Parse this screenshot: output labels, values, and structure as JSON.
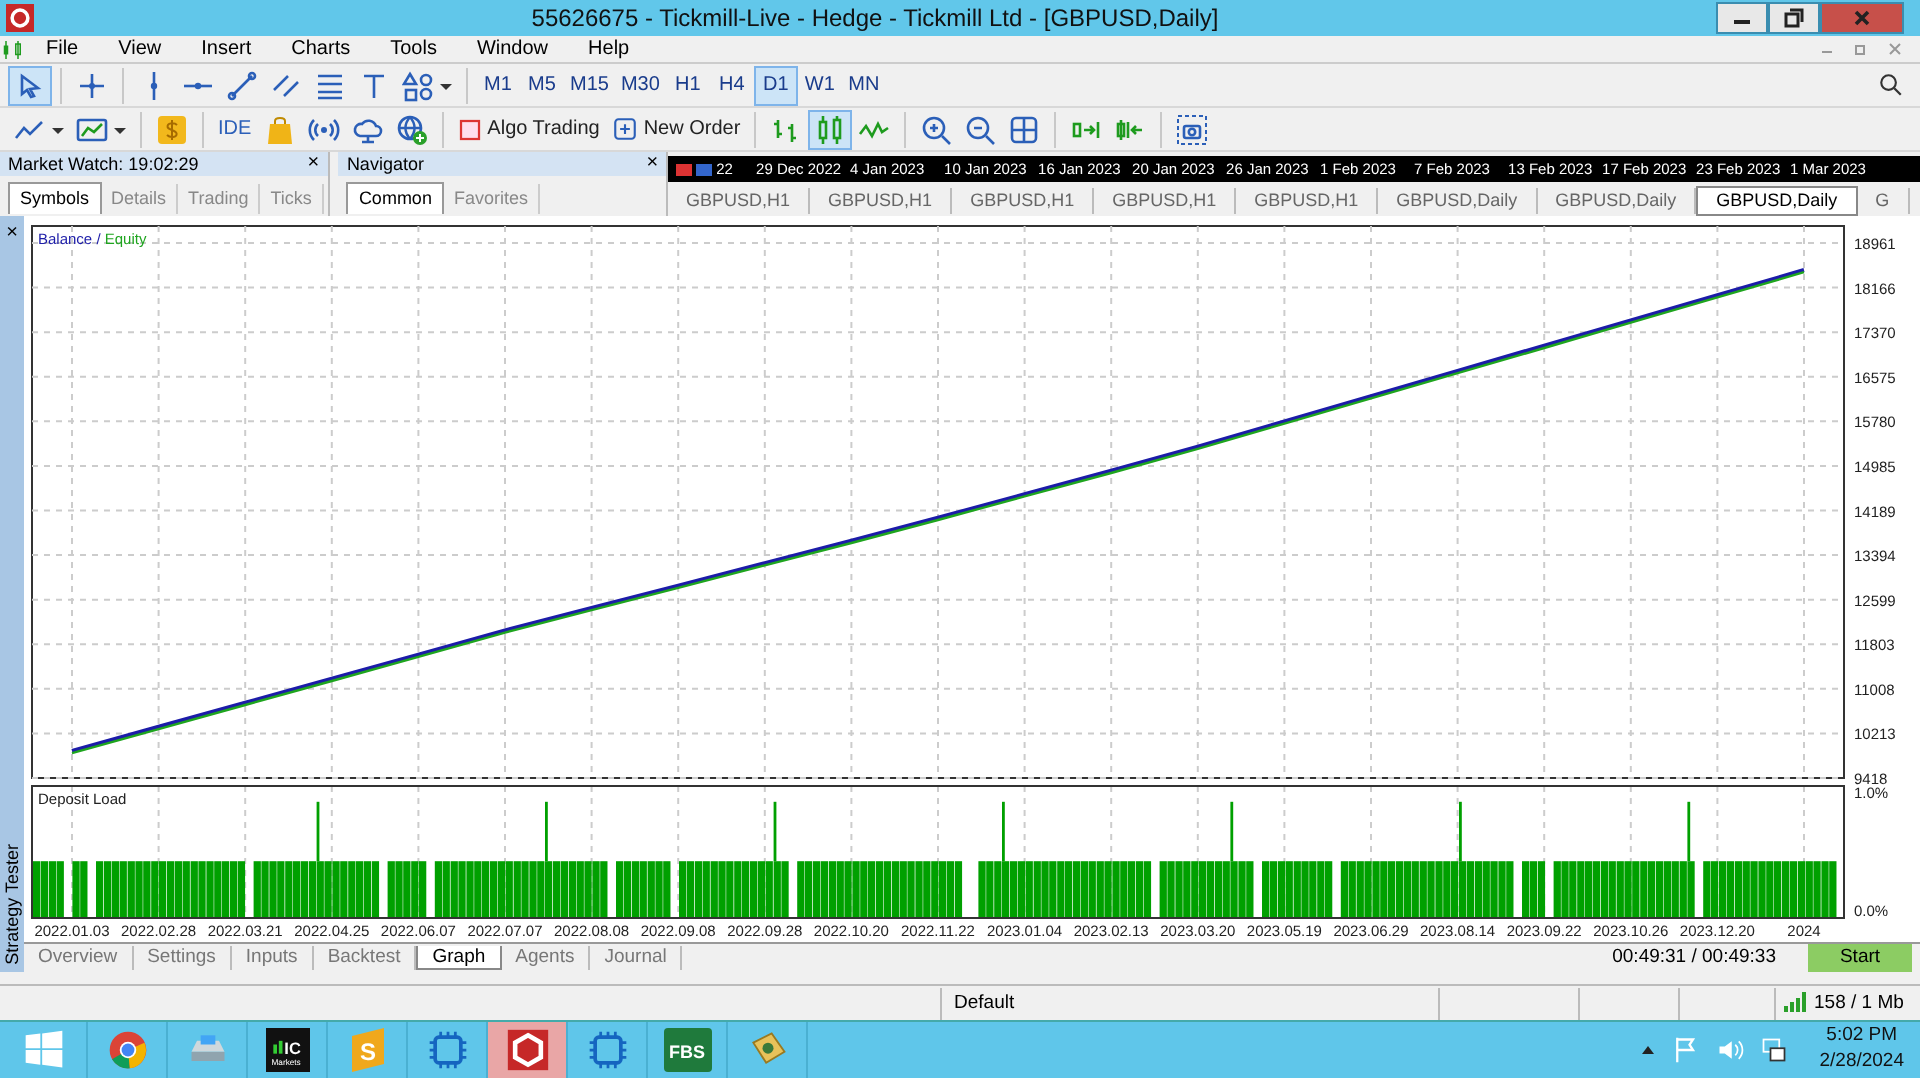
{
  "window": {
    "title": "55626675 - Tickmill-Live - Hedge - Tickmill Ltd - [GBPUSD,Daily]"
  },
  "menu": [
    "File",
    "View",
    "Insert",
    "Charts",
    "Tools",
    "Window",
    "Help"
  ],
  "toolbar": {
    "tools": [
      {
        "kind": "cursor",
        "selected": true
      },
      {
        "kind": "crosshair",
        "selected": false
      },
      {
        "kind": "vline",
        "selected": false
      },
      {
        "kind": "hline",
        "selected": false
      },
      {
        "kind": "trend",
        "selected": false
      },
      {
        "kind": "channel",
        "selected": false
      },
      {
        "kind": "fibo",
        "selected": false
      },
      {
        "kind": "text",
        "selected": false
      },
      {
        "kind": "shapes",
        "selected": false
      }
    ],
    "timeframes": [
      {
        "label": "M1",
        "selected": false
      },
      {
        "label": "M5",
        "selected": false
      },
      {
        "label": "M15",
        "selected": false
      },
      {
        "label": "M30",
        "selected": false
      },
      {
        "label": "H1",
        "selected": false
      },
      {
        "label": "H4",
        "selected": false
      },
      {
        "label": "D1",
        "selected": true
      },
      {
        "label": "W1",
        "selected": false
      },
      {
        "label": "MN",
        "selected": false
      }
    ],
    "actions": [
      {
        "kind": "line_chart"
      },
      {
        "kind": "template"
      },
      {
        "kind": "dollar"
      },
      {
        "kind": "ide",
        "label": "IDE"
      },
      {
        "kind": "bag"
      },
      {
        "kind": "signal"
      },
      {
        "kind": "cloud"
      },
      {
        "kind": "vps"
      }
    ],
    "algo_trading": {
      "label": "Algo Trading",
      "on": false
    },
    "new_order": {
      "label": "New Order"
    },
    "chart_types": [
      {
        "kind": "bars",
        "selected": false
      },
      {
        "kind": "candles",
        "selected": true
      },
      {
        "kind": "line",
        "selected": false
      }
    ],
    "view_tools": [
      {
        "kind": "zoom_in"
      },
      {
        "kind": "zoom_out"
      },
      {
        "kind": "grid"
      },
      {
        "kind": "shift"
      },
      {
        "kind": "autoscroll"
      },
      {
        "kind": "screenshot"
      }
    ]
  },
  "market_watch": {
    "title": "Market Watch: 19:02:29",
    "close": "×",
    "tabs": [
      {
        "label": "Symbols",
        "selected": true
      },
      {
        "label": "Details",
        "selected": false
      },
      {
        "label": "Trading",
        "selected": false
      },
      {
        "label": "Ticks",
        "selected": false
      }
    ]
  },
  "navigator": {
    "title": "Navigator",
    "close": "×",
    "tabs": [
      {
        "label": "Common",
        "selected": true
      },
      {
        "label": "Favorites",
        "selected": false
      }
    ]
  },
  "time_axis": [
    "22",
    "29 Dec 2022",
    "4 Jan 2023",
    "10 Jan 2023",
    "16 Jan 2023",
    "20 Jan 2023",
    "26 Jan 2023",
    "1 Feb 2023",
    "7 Feb 2023",
    "13 Feb 2023",
    "17 Feb 2023",
    "23 Feb 2023",
    "1 Mar 2023"
  ],
  "chart_tabs": [
    {
      "label": "GBPUSD,H1",
      "selected": false
    },
    {
      "label": "GBPUSD,H1",
      "selected": false
    },
    {
      "label": "GBPUSD,H1",
      "selected": false
    },
    {
      "label": "GBPUSD,H1",
      "selected": false
    },
    {
      "label": "GBPUSD,H1",
      "selected": false
    },
    {
      "label": "GBPUSD,Daily",
      "selected": false
    },
    {
      "label": "GBPUSD,Daily",
      "selected": false
    },
    {
      "label": "GBPUSD,Daily",
      "selected": true
    },
    {
      "label": "G",
      "selected": false
    }
  ],
  "tester": {
    "side_title": "Strategy Tester",
    "close": "×",
    "balance_chart": {
      "legend_separator": "/",
      "chart_data": {
        "type": "line",
        "grid": true,
        "categories": [
          null,
          null,
          null,
          null,
          null,
          null,
          null,
          null,
          null,
          null,
          null,
          null,
          null,
          null,
          null,
          null,
          null,
          null,
          null,
          null,
          null
        ],
        "ylim": [
          9418,
          19265
        ],
        "yticks": [
          9418,
          10213,
          11008,
          11803,
          12599,
          13394,
          14189,
          14985,
          15780,
          16575,
          17370,
          18166,
          18961
        ],
        "series": [
          {
            "name": "Balance",
            "color": "#1c1ca8",
            "values": [
              9900,
              10330,
              10760,
              11190,
              11620,
              12050,
              12450,
              12850,
              13250,
              13650,
              14060,
              14480,
              14900,
              15330,
              15780,
              16230,
              16680,
              17130,
              17580,
              18030,
              18480
            ]
          },
          {
            "name": "Equity",
            "color": "#1fa51f",
            "values": [
              9860,
              10290,
              10720,
              11150,
              11580,
              12010,
              12410,
              12810,
              13210,
              13610,
              14020,
              14440,
              14860,
              15290,
              15740,
              16190,
              16640,
              17090,
              17540,
              17990,
              18440
            ]
          }
        ]
      }
    },
    "date_axis": [
      "2022.01.03",
      "2022.02.28",
      "2022.03.21",
      "2022.04.25",
      "2022.06.07",
      "2022.07.07",
      "2022.08.08",
      "2022.09.08",
      "2022.09.28",
      "2022.10.20",
      "2022.11.22",
      "2023.01.04",
      "2023.02.13",
      "2023.03.20",
      "2023.05.19",
      "2023.06.29",
      "2023.08.14",
      "2023.09.22",
      "2023.10.26",
      "2023.12.20",
      "2024"
    ],
    "deposit_load": {
      "title": "Deposit Load",
      "yticks": [
        "1.0%",
        "0.0%"
      ]
    },
    "tabs": [
      {
        "label": "Overview",
        "selected": false
      },
      {
        "label": "Settings",
        "selected": false
      },
      {
        "label": "Inputs",
        "selected": false
      },
      {
        "label": "Backtest",
        "selected": false
      },
      {
        "label": "Graph",
        "selected": true
      },
      {
        "label": "Agents",
        "selected": false
      },
      {
        "label": "Journal",
        "selected": false
      }
    ],
    "elapsed": "00:49:31 / 00:49:33",
    "start_button": "Start"
  },
  "status_bar": {
    "profile": "Default",
    "traffic": "158 / 1 Mb"
  },
  "taskbar": {
    "apps": [
      {
        "kind": "start",
        "selected": false
      },
      {
        "kind": "chrome",
        "selected": false
      },
      {
        "kind": "drive",
        "selected": false
      },
      {
        "kind": "icmarkets",
        "label": "IC",
        "sublabel": "Markets",
        "selected": false
      },
      {
        "kind": "sublime",
        "label": "S",
        "selected": false
      },
      {
        "kind": "chip",
        "selected": false
      },
      {
        "kind": "mt5",
        "selected": true
      },
      {
        "kind": "chip",
        "selected": false
      },
      {
        "kind": "fbs",
        "label": "FBS",
        "selected": false
      },
      {
        "kind": "cert",
        "selected": false
      }
    ],
    "clock_time": "5:02 PM",
    "clock_date": "2/28/2024"
  }
}
